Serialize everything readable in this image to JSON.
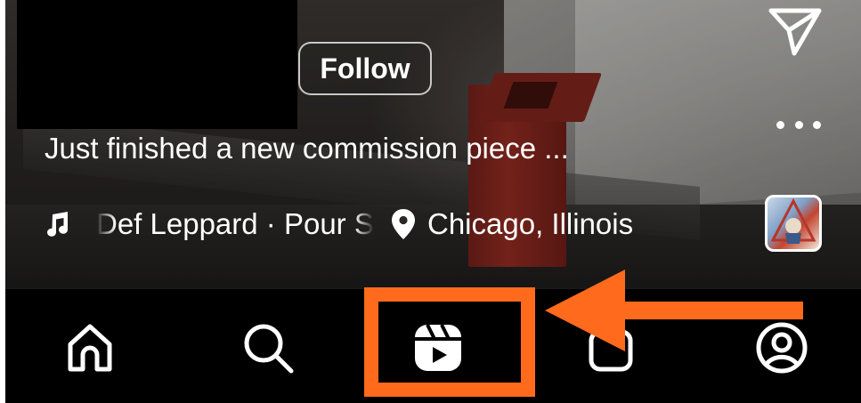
{
  "post": {
    "follow_label": "Follow",
    "caption": "Just finished a new commission piece ...",
    "music": "Def Leppard · Pour Some Sugar On Me",
    "location": "Chicago, Illinois"
  },
  "icons": {
    "send": "paper-plane-icon",
    "more": "more-options-icon",
    "music": "music-note-icon",
    "location": "location-pin-icon",
    "album": "album-art-thumbnail"
  },
  "nav": {
    "items": [
      {
        "id": "home",
        "icon": "home-icon"
      },
      {
        "id": "search",
        "icon": "search-icon"
      },
      {
        "id": "reels",
        "icon": "reels-icon",
        "active": true
      },
      {
        "id": "shop",
        "icon": "shop-icon"
      },
      {
        "id": "profile",
        "icon": "profile-icon"
      }
    ]
  },
  "annotation": {
    "highlight_color": "#ff6a1c",
    "target": "reels"
  }
}
